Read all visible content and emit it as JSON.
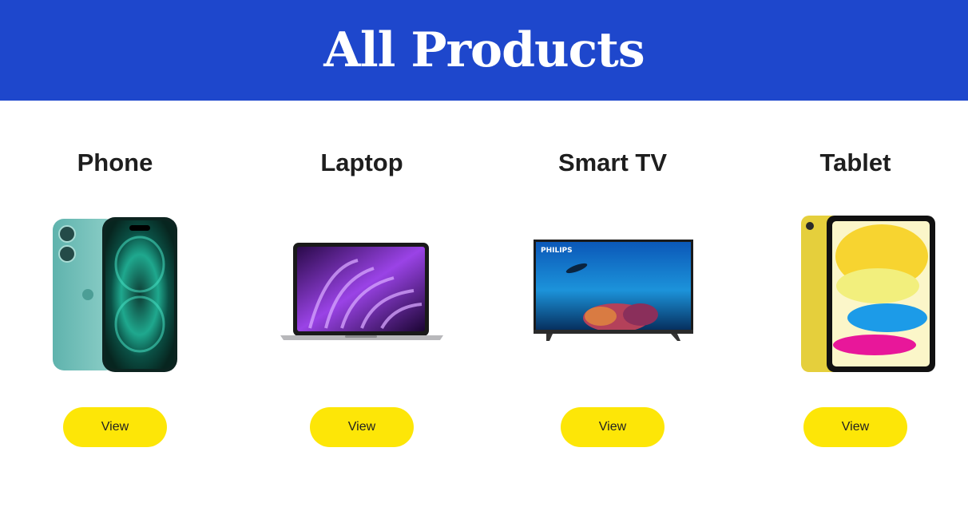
{
  "header": {
    "title": "All Products"
  },
  "products": [
    {
      "title": "Phone",
      "image_icon": "phone-image",
      "button_label": "View"
    },
    {
      "title": "Laptop",
      "image_icon": "laptop-image",
      "button_label": "View"
    },
    {
      "title": "Smart TV",
      "image_icon": "tv-image",
      "tv_brand": "PHILIPS",
      "button_label": "View"
    },
    {
      "title": "Tablet",
      "image_icon": "tablet-image",
      "button_label": "View"
    }
  ],
  "colors": {
    "header_bg": "#1e47cc",
    "button_bg": "#fde607",
    "text": "#1e1e1e"
  }
}
